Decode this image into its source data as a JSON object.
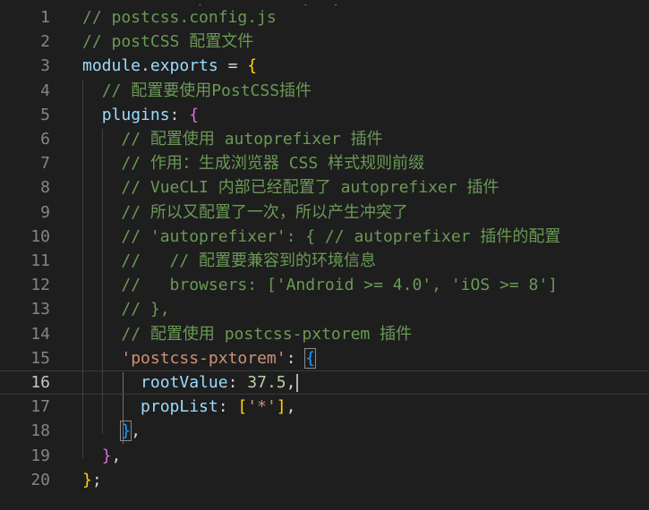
{
  "header_fragment": "                          ,             ,   ,",
  "lines": [
    {
      "n": "1",
      "tokens": [
        {
          "t": "// postcss.config.js",
          "c": "cmt"
        }
      ]
    },
    {
      "n": "2",
      "tokens": [
        {
          "t": "// postCSS 配置文件",
          "c": "cmt"
        }
      ]
    },
    {
      "n": "3",
      "tokens": [
        {
          "t": "module",
          "c": "kw"
        },
        {
          "t": ".",
          "c": "punct"
        },
        {
          "t": "exports",
          "c": "kw"
        },
        {
          "t": " = ",
          "c": "punct"
        },
        {
          "t": "{",
          "c": "b1"
        }
      ]
    },
    {
      "n": "4",
      "tokens": [
        {
          "t": "  ",
          "c": "punct"
        },
        {
          "t": "// 配置要使用PostCSS插件",
          "c": "cmt"
        }
      ]
    },
    {
      "n": "5",
      "tokens": [
        {
          "t": "  ",
          "c": "punct"
        },
        {
          "t": "plugins",
          "c": "kw"
        },
        {
          "t": ": ",
          "c": "punct"
        },
        {
          "t": "{",
          "c": "b2"
        }
      ]
    },
    {
      "n": "6",
      "tokens": [
        {
          "t": "    ",
          "c": "punct"
        },
        {
          "t": "// 配置使用 autoprefixer 插件",
          "c": "cmt"
        }
      ]
    },
    {
      "n": "7",
      "tokens": [
        {
          "t": "    ",
          "c": "punct"
        },
        {
          "t": "// 作用：生成浏览器 CSS 样式规则前缀",
          "c": "cmt"
        }
      ]
    },
    {
      "n": "8",
      "tokens": [
        {
          "t": "    ",
          "c": "punct"
        },
        {
          "t": "// VueCLI 内部已经配置了 autoprefixer 插件",
          "c": "cmt"
        }
      ]
    },
    {
      "n": "9",
      "tokens": [
        {
          "t": "    ",
          "c": "punct"
        },
        {
          "t": "// 所以又配置了一次，所以产生冲突了",
          "c": "cmt"
        }
      ]
    },
    {
      "n": "10",
      "tokens": [
        {
          "t": "    ",
          "c": "punct"
        },
        {
          "t": "// 'autoprefixer': { // autoprefixer 插件的配置",
          "c": "cmt"
        }
      ]
    },
    {
      "n": "11",
      "tokens": [
        {
          "t": "    ",
          "c": "punct"
        },
        {
          "t": "//   // 配置要兼容到的环境信息",
          "c": "cmt"
        }
      ]
    },
    {
      "n": "12",
      "tokens": [
        {
          "t": "    ",
          "c": "punct"
        },
        {
          "t": "//   browsers: ['Android >= 4.0', 'iOS >= 8']",
          "c": "cmt"
        }
      ]
    },
    {
      "n": "13",
      "tokens": [
        {
          "t": "    ",
          "c": "punct"
        },
        {
          "t": "// },",
          "c": "cmt"
        }
      ]
    },
    {
      "n": "14",
      "tokens": [
        {
          "t": "    ",
          "c": "punct"
        },
        {
          "t": "// 配置使用 postcss-pxtorem 插件",
          "c": "cmt"
        }
      ]
    },
    {
      "n": "15",
      "tokens": [
        {
          "t": "    ",
          "c": "punct"
        },
        {
          "t": "'postcss-pxtorem'",
          "c": "str"
        },
        {
          "t": ": ",
          "c": "punct"
        },
        {
          "t": "{",
          "c": "b3 b3box"
        }
      ]
    },
    {
      "n": "16",
      "current": true,
      "tokens": [
        {
          "t": "      ",
          "c": "punct"
        },
        {
          "t": "rootValue",
          "c": "kw"
        },
        {
          "t": ": ",
          "c": "punct"
        },
        {
          "t": "37.5",
          "c": "num"
        },
        {
          "t": ",",
          "c": "punct"
        },
        {
          "t": "",
          "c": "cursor"
        }
      ]
    },
    {
      "n": "17",
      "tokens": [
        {
          "t": "      ",
          "c": "punct"
        },
        {
          "t": "propList",
          "c": "kw"
        },
        {
          "t": ": ",
          "c": "punct"
        },
        {
          "t": "[",
          "c": "b1"
        },
        {
          "t": "'*'",
          "c": "str"
        },
        {
          "t": "]",
          "c": "b1"
        },
        {
          "t": ",",
          "c": "punct"
        }
      ]
    },
    {
      "n": "18",
      "tokens": [
        {
          "t": "    ",
          "c": "punct"
        },
        {
          "t": "}",
          "c": "b3 b3box"
        },
        {
          "t": ",",
          "c": "punct"
        }
      ]
    },
    {
      "n": "19",
      "tokens": [
        {
          "t": "  ",
          "c": "punct"
        },
        {
          "t": "}",
          "c": "b2"
        },
        {
          "t": ",",
          "c": "punct"
        }
      ]
    },
    {
      "n": "20",
      "tokens": [
        {
          "t": "}",
          "c": "b1"
        },
        {
          "t": ";",
          "c": "punct"
        }
      ]
    }
  ]
}
